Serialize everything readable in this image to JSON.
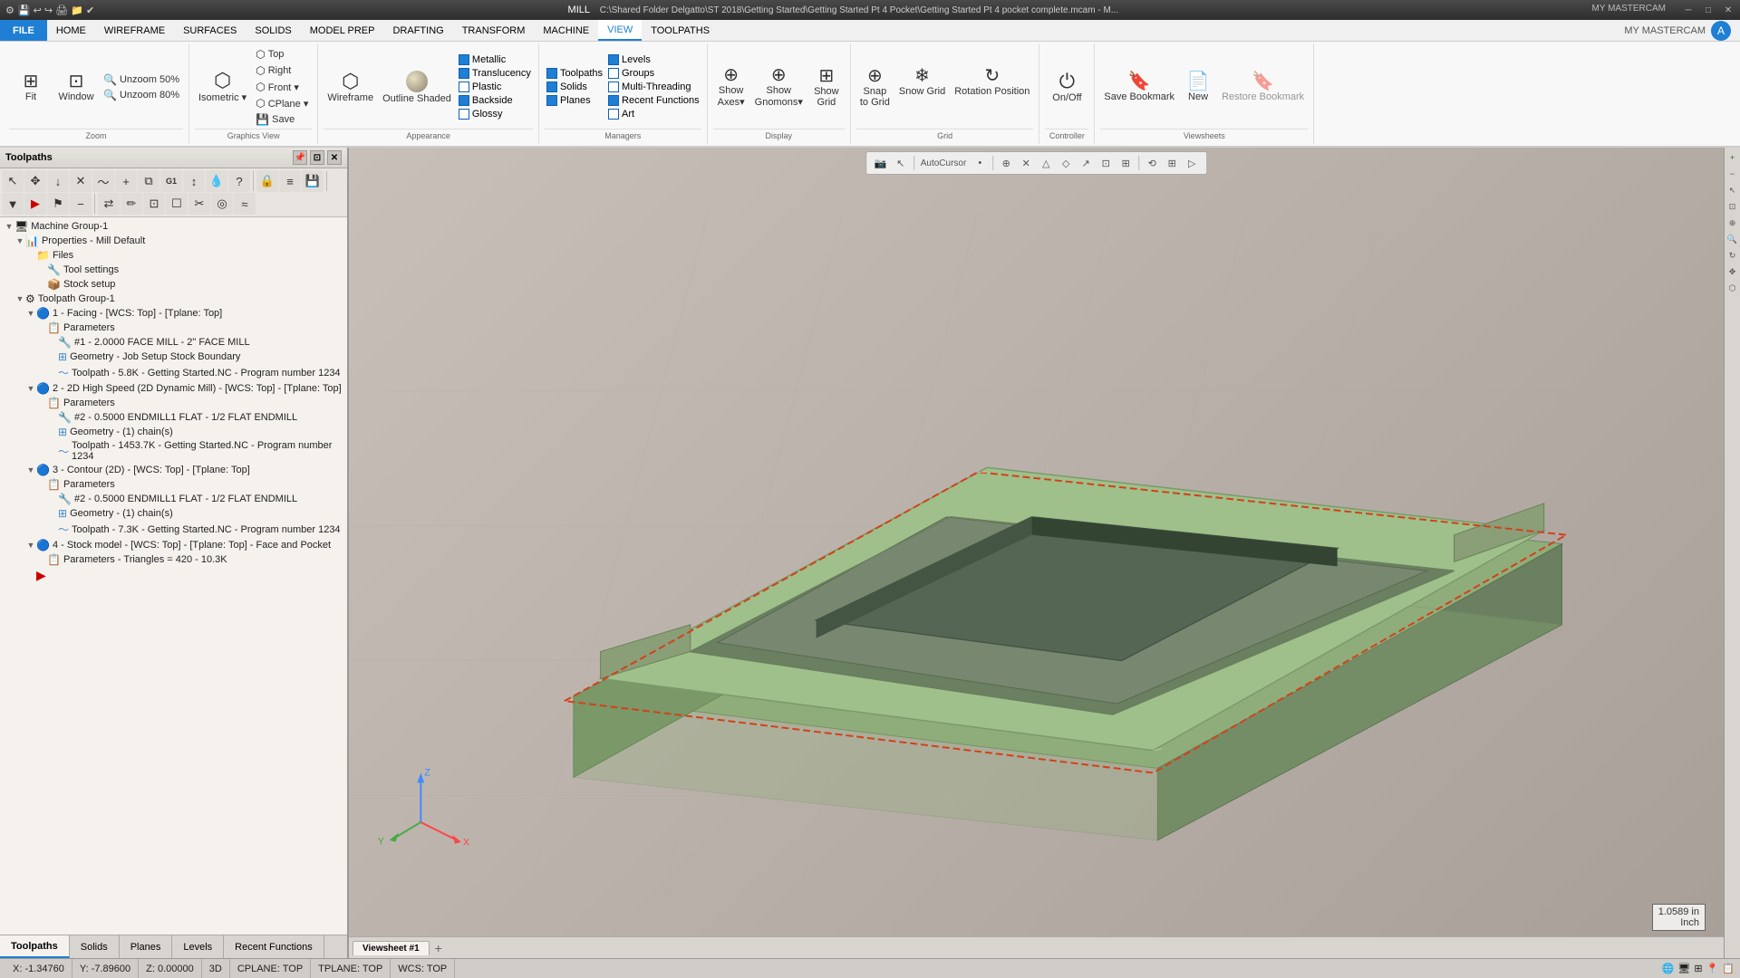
{
  "app": {
    "title": "MILL",
    "filepath": "C:\\Shared Folder Delgatto\\ST 2018\\Getting Started\\Getting Started Pt 4 Pocket\\Getting Started Pt 4 pocket complete.mcam - M...",
    "my_mastercam": "MY MASTERCAM"
  },
  "titlebar": {
    "min": "─",
    "max": "□",
    "close": "✕"
  },
  "menu": {
    "items": [
      "FILE",
      "HOME",
      "WIREFRAME",
      "SURFACES",
      "SOLIDS",
      "MODEL PREP",
      "DRAFTING",
      "TRANSFORM",
      "MACHINE",
      "VIEW",
      "TOOLPATHS"
    ]
  },
  "ribbon": {
    "groups": [
      {
        "name": "zoom",
        "label": "Zoom",
        "buttons": [
          {
            "id": "fit",
            "label": "Fit",
            "icon": "⊞"
          },
          {
            "id": "window",
            "label": "Window",
            "icon": "⊡"
          }
        ],
        "small_buttons": [
          {
            "id": "unzoom50",
            "label": "Unzoom 50%",
            "icon": "🔍"
          },
          {
            "id": "unzoom80",
            "label": "Unzoom 80%",
            "icon": "🔍"
          }
        ]
      },
      {
        "name": "graphics_view",
        "label": "Graphics View",
        "buttons": [
          {
            "id": "isometric",
            "label": "Isometric",
            "icon": "⬡",
            "dropdown": true
          },
          {
            "id": "top",
            "label": "Top",
            "icon": "⬡"
          },
          {
            "id": "right",
            "label": "Right",
            "icon": "⬡"
          },
          {
            "id": "front",
            "label": "Front",
            "icon": "⬡",
            "dropdown": true
          },
          {
            "id": "cplane",
            "label": "CPlane",
            "icon": "⬡",
            "dropdown": true
          },
          {
            "id": "save_gv",
            "label": "Save",
            "icon": "💾"
          }
        ]
      },
      {
        "name": "appearance",
        "label": "Appearance",
        "buttons": [
          {
            "id": "wireframe",
            "label": "Wireframe",
            "icon": "⬡"
          },
          {
            "id": "outline_shaded",
            "label": "Outline Shaded",
            "icon": "⬡"
          }
        ],
        "checks": [
          {
            "id": "metallic",
            "label": "Metallic",
            "checked": true
          },
          {
            "id": "translucency",
            "label": "Translucency",
            "checked": true
          },
          {
            "id": "plastic",
            "label": "Plastic",
            "checked": false
          },
          {
            "id": "backside",
            "label": "Backside",
            "checked": true
          },
          {
            "id": "glossy",
            "label": "Glossy",
            "checked": false
          }
        ]
      },
      {
        "name": "managers",
        "label": "Managers",
        "checks": [
          {
            "id": "toolpaths",
            "label": "Toolpaths",
            "checked": true
          },
          {
            "id": "solids",
            "label": "Solids",
            "checked": true
          },
          {
            "id": "planes",
            "label": "Planes",
            "checked": true
          },
          {
            "id": "levels",
            "label": "Levels",
            "checked": true
          },
          {
            "id": "groups",
            "label": "Groups",
            "checked": false
          },
          {
            "id": "multi_threading",
            "label": "Multi-Threading",
            "checked": false
          },
          {
            "id": "recent_functions",
            "label": "Recent Functions",
            "checked": true
          },
          {
            "id": "art",
            "label": "Art",
            "checked": false
          }
        ]
      },
      {
        "name": "display",
        "label": "Display",
        "buttons": [
          {
            "id": "show_axes",
            "label": "Show Axes",
            "icon": "⊕"
          },
          {
            "id": "show_gnomons",
            "label": "Show Gnomons",
            "icon": "⊕"
          },
          {
            "id": "show_grid",
            "label": "Show Grid",
            "icon": "⊞"
          }
        ]
      },
      {
        "name": "grid",
        "label": "Grid",
        "buttons": [
          {
            "id": "snap_to_grid",
            "label": "Snap to Grid",
            "icon": "⊕"
          },
          {
            "id": "snow_grid",
            "label": "Snow Grid",
            "icon": "❄"
          }
        ],
        "rotation_position": {
          "label": "Rotation Position",
          "icon": "↻"
        }
      },
      {
        "name": "controller",
        "label": "Controller",
        "buttons": [
          {
            "id": "on_off",
            "label": "On/Off",
            "icon": "⏻"
          }
        ]
      },
      {
        "name": "viewsheets",
        "label": "Viewsheets",
        "buttons": [
          {
            "id": "save_bookmark",
            "label": "Save Bookmark",
            "icon": "🔖"
          },
          {
            "id": "new_vs",
            "label": "New",
            "icon": "📄"
          },
          {
            "id": "restore_bookmark",
            "label": "Restore Bookmark",
            "icon": "🔖"
          }
        ]
      }
    ]
  },
  "toolpaths_panel": {
    "title": "Toolpaths",
    "toolbar_buttons": [
      {
        "id": "select",
        "icon": "↖",
        "label": "Select"
      },
      {
        "id": "move",
        "icon": "✥",
        "label": "Move"
      },
      {
        "id": "expand",
        "icon": "↓",
        "label": "Expand"
      },
      {
        "id": "delete",
        "icon": "✕",
        "label": "Delete"
      },
      {
        "id": "wave",
        "icon": "〜",
        "label": "Wave"
      },
      {
        "id": "add",
        "icon": "+",
        "label": "Add"
      },
      {
        "id": "copy",
        "icon": "⧉",
        "label": "Copy"
      },
      {
        "id": "g1",
        "icon": "G1",
        "label": "G1"
      },
      {
        "id": "t1",
        "icon": "↕",
        "label": "T1"
      },
      {
        "id": "drip",
        "icon": "💧",
        "label": "Drip"
      },
      {
        "id": "help",
        "icon": "?",
        "label": "Help"
      },
      {
        "id": "lock",
        "icon": "🔒",
        "label": "Lock"
      },
      {
        "id": "layers",
        "icon": "≡",
        "label": "Layers"
      },
      {
        "id": "save2",
        "icon": "💾",
        "label": "Save"
      },
      {
        "id": "filter",
        "icon": "▼",
        "label": "Filter"
      },
      {
        "id": "run",
        "icon": "▶",
        "label": "Run"
      },
      {
        "id": "flag",
        "icon": "⚑",
        "label": "Flag"
      },
      {
        "id": "minus",
        "icon": "−",
        "label": "Minus"
      },
      {
        "id": "move2",
        "icon": "⇄",
        "label": "Move2"
      },
      {
        "id": "edit",
        "icon": "✏",
        "label": "Edit"
      },
      {
        "id": "sel2",
        "icon": "⊡",
        "label": "Sel2"
      },
      {
        "id": "mark",
        "icon": "☐",
        "label": "Mark"
      },
      {
        "id": "trim",
        "icon": "✂",
        "label": "Trim"
      },
      {
        "id": "view2",
        "icon": "◎",
        "label": "View2"
      },
      {
        "id": "misc",
        "icon": "≈",
        "label": "Misc"
      }
    ],
    "tree": {
      "items": [
        {
          "id": "machine-group-1",
          "level": 0,
          "expand": "▼",
          "icon": "🖥",
          "label": "Machine Group-1",
          "type": "machine"
        },
        {
          "id": "properties",
          "level": 1,
          "expand": "▼",
          "icon": "📊",
          "label": "Properties - Mill Default",
          "type": "properties"
        },
        {
          "id": "files",
          "level": 2,
          "expand": " ",
          "icon": "📁",
          "label": "Files",
          "type": "folder"
        },
        {
          "id": "tool-settings",
          "level": 3,
          "expand": " ",
          "icon": "🔧",
          "label": "Tool settings",
          "type": "settings"
        },
        {
          "id": "stock-setup",
          "level": 3,
          "expand": " ",
          "icon": "📦",
          "label": "Stock setup",
          "type": "settings"
        },
        {
          "id": "toolpath-group-1",
          "level": 1,
          "expand": "▼",
          "icon": "⚙",
          "label": "Toolpath Group-1",
          "type": "group"
        },
        {
          "id": "op1",
          "level": 2,
          "expand": "▼",
          "icon": "🔵",
          "label": "1 - Facing - [WCS: Top] - [Tplane: Top]",
          "type": "operation"
        },
        {
          "id": "op1-params",
          "level": 3,
          "expand": " ",
          "icon": "📋",
          "label": "Parameters",
          "type": "params"
        },
        {
          "id": "op1-tool",
          "level": 4,
          "expand": " ",
          "icon": "🔧",
          "label": "#1 - 2.0000 FACE MILL - 2\" FACE MILL",
          "type": "tool"
        },
        {
          "id": "op1-geo",
          "level": 4,
          "expand": " ",
          "icon": "⊞",
          "label": "Geometry - Job Setup Stock Boundary",
          "type": "geometry"
        },
        {
          "id": "op1-toolpath",
          "level": 4,
          "expand": " ",
          "icon": "〜",
          "label": "Toolpath - 5.8K - Getting Started.NC - Program number 1234",
          "type": "toolpath"
        },
        {
          "id": "op2",
          "level": 2,
          "expand": "▼",
          "icon": "🔵",
          "label": "2 - 2D High Speed (2D Dynamic Mill) - [WCS: Top] - [Tplane: Top]",
          "type": "operation"
        },
        {
          "id": "op2-params",
          "level": 3,
          "expand": " ",
          "icon": "📋",
          "label": "Parameters",
          "type": "params"
        },
        {
          "id": "op2-tool",
          "level": 4,
          "expand": " ",
          "icon": "🔧",
          "label": "#2 - 0.5000 ENDMILL1 FLAT - 1/2 FLAT ENDMILL",
          "type": "tool"
        },
        {
          "id": "op2-geo",
          "level": 4,
          "expand": " ",
          "icon": "⊞",
          "label": "Geometry - (1) chain(s)",
          "type": "geometry"
        },
        {
          "id": "op2-toolpath",
          "level": 4,
          "expand": " ",
          "icon": "〜",
          "label": "Toolpath - 1453.7K - Getting Started.NC - Program number 1234",
          "type": "toolpath"
        },
        {
          "id": "op3",
          "level": 2,
          "expand": "▼",
          "icon": "🔵",
          "label": "3 - Contour (2D) - [WCS: Top] - [Tplane: Top]",
          "type": "operation"
        },
        {
          "id": "op3-params",
          "level": 3,
          "expand": " ",
          "icon": "📋",
          "label": "Parameters",
          "type": "params"
        },
        {
          "id": "op3-tool",
          "level": 4,
          "expand": " ",
          "icon": "🔧",
          "label": "#2 - 0.5000 ENDMILL1 FLAT - 1/2 FLAT ENDMILL",
          "type": "tool"
        },
        {
          "id": "op3-geo",
          "level": 4,
          "expand": " ",
          "icon": "⊞",
          "label": "Geometry - (1) chain(s)",
          "type": "geometry"
        },
        {
          "id": "op3-toolpath",
          "level": 4,
          "expand": " ",
          "icon": "〜",
          "label": "Toolpath - 7.3K - Getting Started.NC - Program number 1234",
          "type": "toolpath"
        },
        {
          "id": "op4",
          "level": 2,
          "expand": "▼",
          "icon": "🔵",
          "label": "4 - Stock model - [WCS: Top] - [Tplane: Top] - Face and Pocket",
          "type": "operation"
        },
        {
          "id": "op4-params",
          "level": 3,
          "expand": " ",
          "icon": "📋",
          "label": "Parameters - Triangles = 420 - 10.3K",
          "type": "params"
        },
        {
          "id": "arrow",
          "level": 2,
          "expand": " ",
          "icon": "▶",
          "label": "",
          "type": "arrow"
        }
      ]
    },
    "tabs": [
      "Toolpaths",
      "Solids",
      "Planes",
      "Levels",
      "Recent Functions"
    ]
  },
  "viewport": {
    "autocursor": "AutoCursor",
    "viewsheet": "Viewsheet #1",
    "add_viewsheet": "+"
  },
  "status_bar": {
    "x": "X:  -1.34760",
    "y": "Y:  -7.89600",
    "z": "Z:  0.00000",
    "mode": "3D",
    "cplane": "CPLANE: TOP",
    "tplane": "TPLANE: TOP",
    "wcs": "WCS: TOP",
    "icons": [
      "🌐",
      "🖥",
      "⊞",
      "📍",
      "📋"
    ]
  },
  "scale": {
    "value": "1.0589 in",
    "unit": "Inch"
  },
  "colors": {
    "accent": "#1e7fd4",
    "model_fill": "#8fad7a",
    "model_border": "#d4401a",
    "background_top": "#c8c0b8",
    "background_bottom": "#a8a098"
  }
}
